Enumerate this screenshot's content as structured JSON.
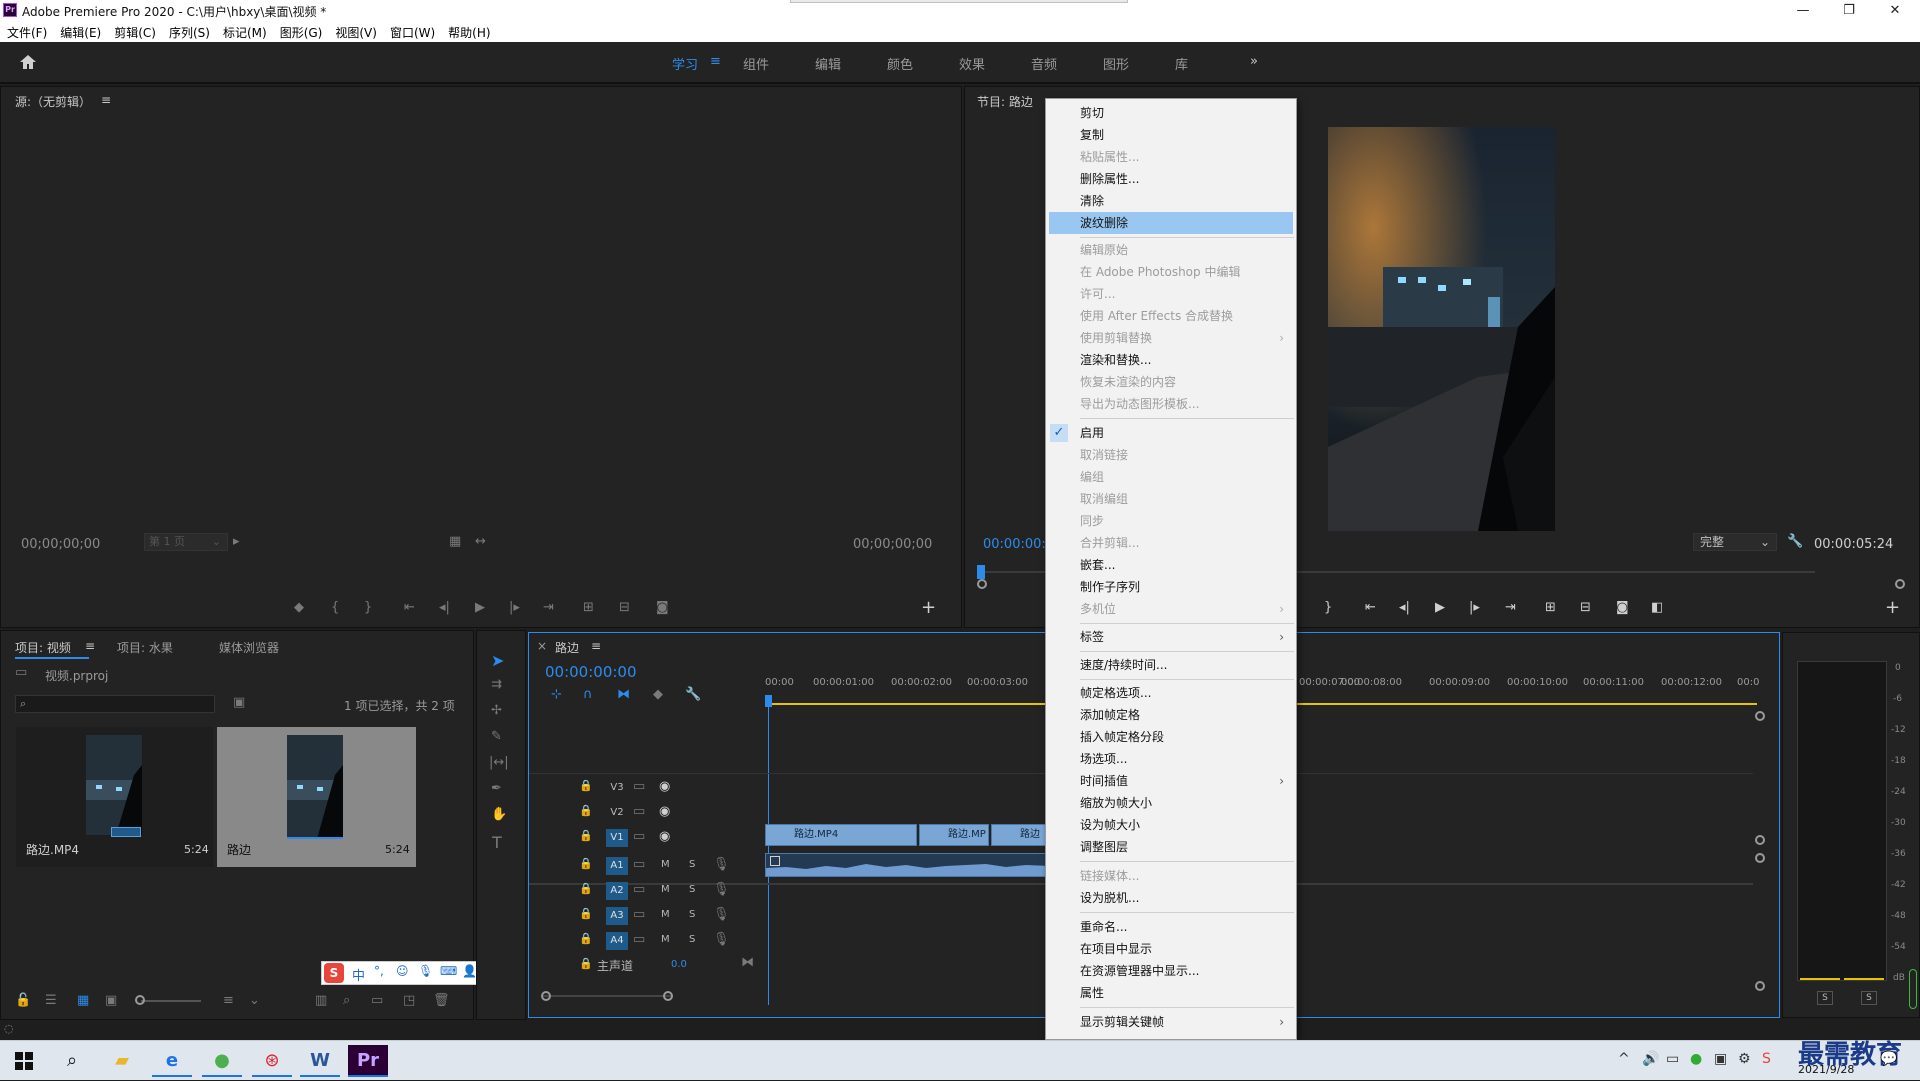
{
  "window": {
    "title": "Adobe Premiere Pro 2020 - C:\\用户\\hbxy\\桌面\\视频 *",
    "logo_text": "Pr",
    "controls": [
      "—",
      "❐",
      "✕"
    ]
  },
  "menubar": [
    "文件(F)",
    "编辑(E)",
    "剪辑(C)",
    "序列(S)",
    "标记(M)",
    "图形(G)",
    "视图(V)",
    "窗口(W)",
    "帮助(H)"
  ],
  "workspaces": {
    "tabs": [
      "学习",
      "组件",
      "编辑",
      "颜色",
      "效果",
      "音频",
      "图形",
      "库"
    ],
    "active_menu_icon": "≡",
    "overflow": "»"
  },
  "source_panel": {
    "title": "源:（无剪辑）",
    "menu_icon": "≡",
    "timecode_in": "00;00;00;00",
    "page_select": "第 1 页",
    "timecode_out": "00;00;00;00",
    "add": "+"
  },
  "program_panel": {
    "title": "节目: 路边",
    "timecode": "00:00:00:",
    "fit": "完整",
    "duration": "00:00:05:24",
    "add": "+"
  },
  "project_panel": {
    "tabs": [
      "项目: 视频",
      "项目: 水果",
      "媒体浏览器"
    ],
    "menu_icon": "≡",
    "file": "视频.prproj",
    "selection_info": "1 项已选择，共 2 项",
    "items": [
      {
        "name": "路边.MP4",
        "duration": "5:24"
      },
      {
        "name": "路边",
        "duration": "5:24"
      }
    ]
  },
  "timeline": {
    "tab": "路边",
    "menu_icon": "≡",
    "close": "×",
    "timecode": "00:00:00:00",
    "ruler_left": [
      "00:00",
      "00:00:01:00",
      "00:00:02:00",
      "00:00:03:00"
    ],
    "ruler_right": [
      "00:00:07:00",
      "00:00:08:00",
      "00:00:09:00",
      "00:00:10:00",
      "00:00:11:00",
      "00:00:12:00",
      "00:0"
    ],
    "video_tracks": [
      "V3",
      "V2",
      "V1"
    ],
    "audio_tracks": [
      "A1",
      "A2",
      "A3",
      "A4"
    ],
    "track_m": "M",
    "track_s": "S",
    "master": {
      "label": "主声道",
      "value": "0.0"
    },
    "clips": [
      "路边.MP4",
      "路边.MP",
      "路边"
    ]
  },
  "meter": {
    "scale": [
      "0",
      "-6",
      "-12",
      "-18",
      "-24",
      "-30",
      "-36",
      "-42",
      "-48",
      "-54",
      "dB"
    ],
    "solo": [
      "S",
      "S"
    ]
  },
  "context_menu": {
    "highlighted": "波纹删除",
    "checked": "启用",
    "items": [
      {
        "label": "剪切",
        "enabled": true
      },
      {
        "label": "复制",
        "enabled": true
      },
      {
        "label": "粘贴属性...",
        "enabled": false
      },
      {
        "label": "删除属性...",
        "enabled": true
      },
      {
        "label": "清除",
        "enabled": true
      },
      {
        "label": "波纹删除",
        "enabled": true
      },
      {
        "label": "编辑原始",
        "enabled": false
      },
      {
        "label": "在 Adobe Photoshop 中编辑",
        "enabled": false
      },
      {
        "label": "许可...",
        "enabled": false
      },
      {
        "label": "使用 After Effects 合成替换",
        "enabled": false
      },
      {
        "label": "使用剪辑替换",
        "enabled": false,
        "submenu": true
      },
      {
        "label": "渲染和替换...",
        "enabled": true
      },
      {
        "label": "恢复未渲染的内容",
        "enabled": false
      },
      {
        "label": "导出为动态图形模板...",
        "enabled": false
      },
      {
        "label": "启用",
        "enabled": true
      },
      {
        "label": "取消链接",
        "enabled": false
      },
      {
        "label": "编组",
        "enabled": false
      },
      {
        "label": "取消编组",
        "enabled": false
      },
      {
        "label": "同步",
        "enabled": false
      },
      {
        "label": "合并剪辑...",
        "enabled": false
      },
      {
        "label": "嵌套...",
        "enabled": true
      },
      {
        "label": "制作子序列",
        "enabled": true
      },
      {
        "label": "多机位",
        "enabled": false,
        "submenu": true
      },
      {
        "label": "标签",
        "enabled": true,
        "submenu": true
      },
      {
        "label": "速度/持续时间...",
        "enabled": true
      },
      {
        "label": "帧定格选项...",
        "enabled": true
      },
      {
        "label": "添加帧定格",
        "enabled": true
      },
      {
        "label": "插入帧定格分段",
        "enabled": true
      },
      {
        "label": "场选项...",
        "enabled": true
      },
      {
        "label": "时间插值",
        "enabled": true,
        "submenu": true
      },
      {
        "label": "缩放为帧大小",
        "enabled": true
      },
      {
        "label": "设为帧大小",
        "enabled": true
      },
      {
        "label": "调整图层",
        "enabled": true
      },
      {
        "label": "链接媒体...",
        "enabled": false
      },
      {
        "label": "设为脱机...",
        "enabled": true
      },
      {
        "label": "重命名...",
        "enabled": true
      },
      {
        "label": "在项目中显示",
        "enabled": true
      },
      {
        "label": "在资源管理器中显示...",
        "enabled": true
      },
      {
        "label": "属性",
        "enabled": true
      },
      {
        "label": "显示剪辑关键帧",
        "enabled": true,
        "submenu": true
      }
    ]
  },
  "ime_toolbar": {
    "logo": "S",
    "mode": "中"
  },
  "taskbar": {
    "date": "2021/9/28",
    "watermark": "最需教育"
  },
  "colors": {
    "accent": "#2d8ceb",
    "panel_bg": "#232323",
    "clip_blue": "#7aa6d6",
    "menu_highlight": "#99c7f2"
  }
}
